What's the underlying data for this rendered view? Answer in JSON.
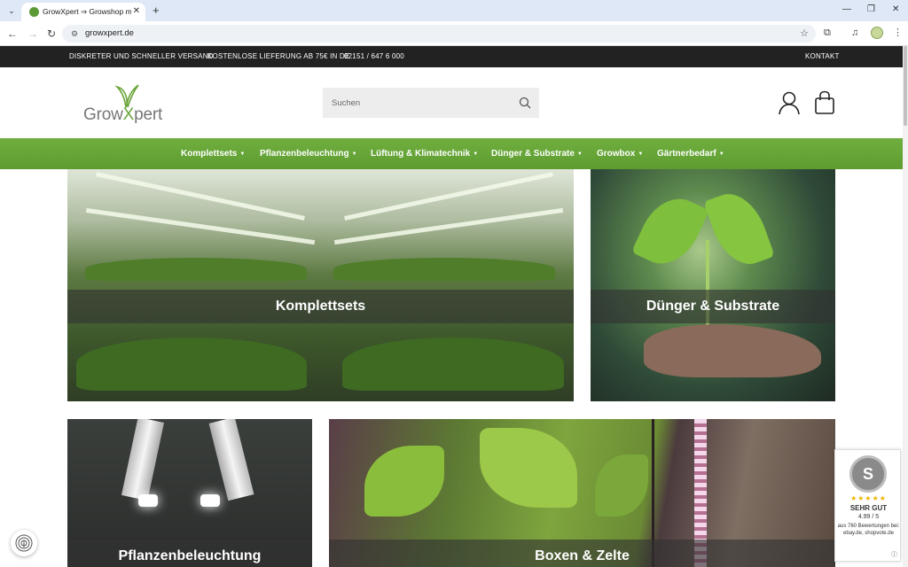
{
  "browser": {
    "tab_title": "GrowXpert ⇒ Growshop mit fa",
    "url": "growxpert.de"
  },
  "topbar": {
    "shipping": "DISKRETER UND SCHNELLER VERSAND",
    "free_delivery": "KOSTENLOSE LIEFERUNG AB 75€ IN DE",
    "phone": "02151 / 647 6 000",
    "contact": "KONTAKT"
  },
  "header": {
    "logo_text_1": "Grow",
    "logo_text_x": "X",
    "logo_text_2": "pert",
    "search_placeholder": "Suchen"
  },
  "nav": {
    "items": [
      {
        "label": "Komplettsets"
      },
      {
        "label": "Pflanzenbeleuchtung"
      },
      {
        "label": "Lüftung & Klimatechnik"
      },
      {
        "label": "Dünger & Substrate"
      },
      {
        "label": "Growbox"
      },
      {
        "label": "Gärtnerbedarf"
      }
    ]
  },
  "tiles": [
    {
      "label": "Komplettsets"
    },
    {
      "label": "Dünger & Substrate"
    },
    {
      "label": "Pflanzenbeleuchtung"
    },
    {
      "label": "Boxen & Zelte"
    }
  ],
  "rating_badge": {
    "seal": "S",
    "stars": "★★★★★",
    "rating": "SEHR GUT",
    "score": "4.99 / 5",
    "source": "aus 760 Bewertungen bei: ebay.de, shopvote.de",
    "info": "ⓘ"
  },
  "colors": {
    "nav_green": "#6aa43a",
    "topbar_dark": "#222222"
  }
}
